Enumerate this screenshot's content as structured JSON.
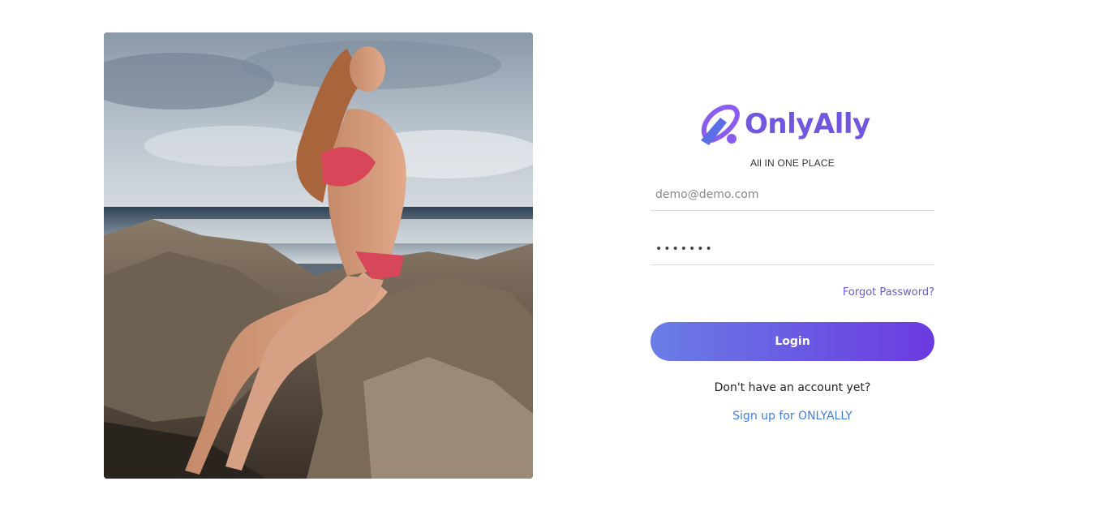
{
  "hero": {
    "image_name": "beach-rocks-photo"
  },
  "brand": {
    "name": "OnlyAlly",
    "tagline": "All IN ONE PLACE",
    "color": "#7356e0",
    "mark_colors": [
      "#8a5cf0",
      "#5b6fe6"
    ]
  },
  "form": {
    "email_placeholder": "demo@demo.com",
    "email_value": "",
    "password_value": "•••••••",
    "forgot_label": "Forgot Password?",
    "login_label": "Login",
    "no_account_text": "Don't have an account yet?",
    "signup_label": "Sign up for ONLYALLY"
  },
  "colors": {
    "button_start": "#6a7de6",
    "button_end": "#6b3ae0",
    "link_forgot": "#6a5ad8",
    "link_signup": "#3d7fe0"
  }
}
